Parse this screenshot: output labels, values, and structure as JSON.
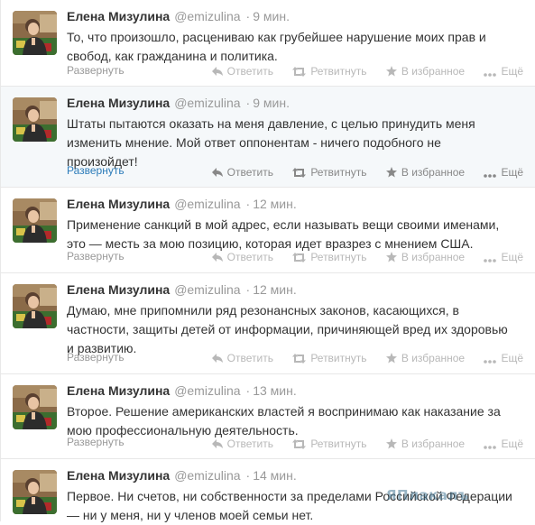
{
  "labels": {
    "expand": "Развернуть",
    "reply": "Ответить",
    "retweet": "Ретвитнуть",
    "favorite": "В избранное",
    "more": "Ещё"
  },
  "tweets": [
    {
      "name": "Елена Мизулина",
      "handle": "@emizulina",
      "time": "9 мин.",
      "text": "То, что произошло, расцениваю как грубейшее нарушение моих прав и свобод, как гражданина и политика."
    },
    {
      "name": "Елена Мизулина",
      "handle": "@emizulina",
      "time": "9 мин.",
      "text": "Штаты пытаются оказать на меня давление, с целью принудить меня изменить мнение. Мой ответ оппонентам - ничего подобного не произойдет!"
    },
    {
      "name": "Елена Мизулина",
      "handle": "@emizulina",
      "time": "12 мин.",
      "text": "Применение санкций в мой адрес, если называть вещи своими именами, это — месть за мою позицию, которая идет вразрез с мнением США."
    },
    {
      "name": "Елена Мизулина",
      "handle": "@emizulina",
      "time": "12 мин.",
      "text": "Думаю, мне припомнили ряд резонансных законов, касающихся, в частности, защиты детей от информации, причиняющей вред их здоровью и развитию."
    },
    {
      "name": "Елена Мизулина",
      "handle": "@emizulina",
      "time": "13 мин.",
      "text": "Второе. Решение американских властей я воспринимаю как наказание за мою профессиональную деятельность."
    },
    {
      "name": "Елена Мизулина",
      "handle": "@emizulina",
      "time": "14 мин.",
      "text": "Первое. Ни счетов, ни собственности за пределами Российской Федерации — ни у меня, ни у членов моей семьи нет."
    }
  ],
  "watermark": "ЯПлакалъ"
}
